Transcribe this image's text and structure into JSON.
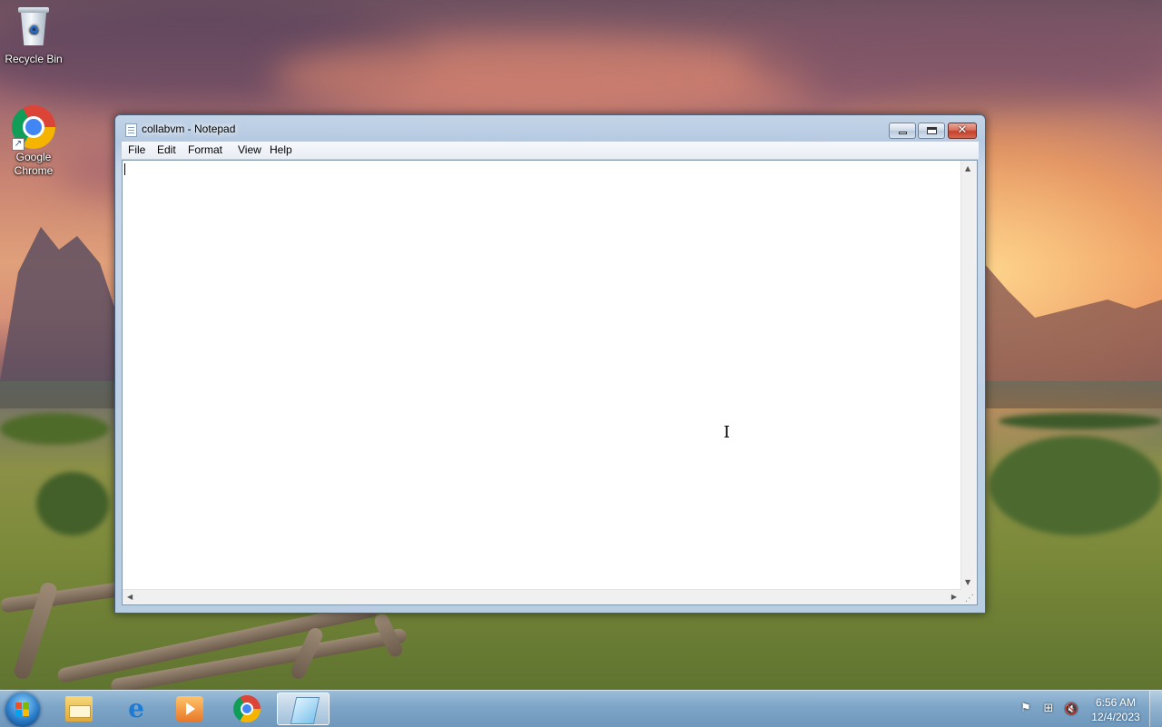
{
  "desktop": {
    "icons": [
      {
        "label": "Recycle Bin",
        "icon": "recycle-bin-icon"
      },
      {
        "label": "Google\nChrome",
        "label_line1": "Google",
        "label_line2": "Chrome",
        "icon": "chrome-icon"
      }
    ]
  },
  "window": {
    "title": "collabvm - Notepad",
    "icon": "notepad-icon",
    "controls": {
      "minimize": "minimize-icon",
      "maximize": "maximize-icon",
      "close_glyph": "✕"
    },
    "menu": [
      "File",
      "Edit",
      "Format",
      "View",
      "Help"
    ],
    "content": "",
    "scroll_up": "▲",
    "scroll_down": "▼",
    "scroll_left": "◀",
    "scroll_right": "▶"
  },
  "cursor": {
    "glyph": "I"
  },
  "taskbar": {
    "start_icon": "windows-logo-icon",
    "pinned": [
      {
        "icon": "file-explorer-icon"
      },
      {
        "icon": "internet-explorer-icon",
        "glyph": "e"
      },
      {
        "icon": "media-player-icon"
      },
      {
        "icon": "chrome-icon"
      },
      {
        "icon": "notepad-icon",
        "active": true
      }
    ],
    "tray": {
      "icons": [
        "action-center-flag-icon",
        "network-icon",
        "volume-muted-icon"
      ],
      "flag_glyph": "⚑",
      "network_glyph": "⊞",
      "volume_glyph": "🔇"
    },
    "clock": {
      "time": "6:56 AM",
      "date": "12/4/2023"
    }
  },
  "colors": {
    "accent": "#2b7cc7",
    "close_button": "#c4422c",
    "taskbar": "#7aa6c8"
  }
}
